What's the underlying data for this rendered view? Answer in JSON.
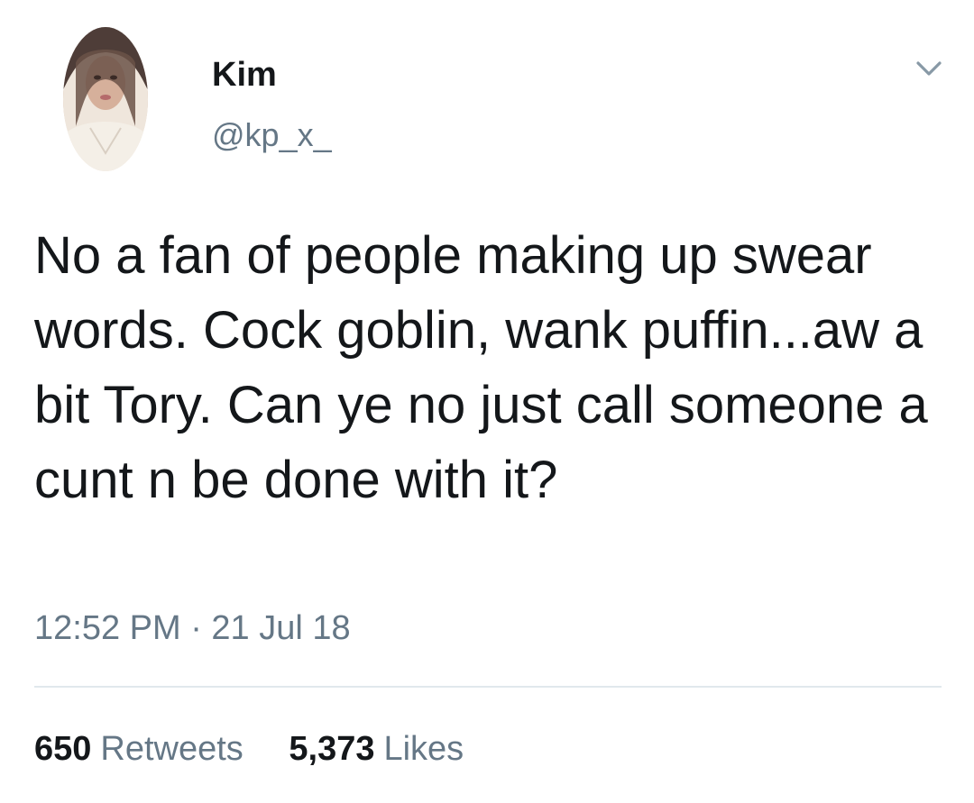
{
  "tweet": {
    "author": {
      "display_name": "Kim",
      "handle": "@kp_x_",
      "avatar_icon": "user-avatar"
    },
    "menu_icon": "chevron-down-icon",
    "text": "No a fan of people making up swear words. Cock goblin, wank puffin...aw a bit Tory. Can ye no just call someone a cunt n be done with it?",
    "timestamp": "12:52 PM · 21 Jul 18",
    "stats": {
      "retweets": {
        "count": "650",
        "label": "Retweets"
      },
      "likes": {
        "count": "5,373",
        "label": "Likes"
      }
    }
  },
  "colors": {
    "text": "#14171a",
    "secondary_text": "#657786",
    "divider": "#e1e8ed",
    "background": "#ffffff"
  }
}
